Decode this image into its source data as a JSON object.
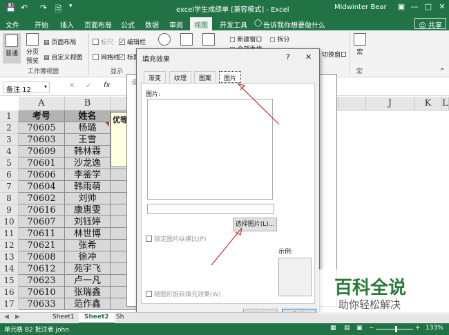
{
  "window": {
    "title": "excel学生成绩单 [兼容模式] - Excel",
    "user": "Midwinter Bear",
    "accent_color": "#217346"
  },
  "qat": {
    "save_icon": "save-icon",
    "undo_icon": "undo-icon",
    "redo_icon": "redo-icon",
    "new_icon": "new-icon"
  },
  "menu": {
    "tabs": [
      "文件",
      "开始",
      "插入",
      "页面布局",
      "公式",
      "数据",
      "审阅",
      "视图",
      "开发工具"
    ],
    "tell_me": "告诉我你想要做什么",
    "share": "共享"
  },
  "ribbon": {
    "normal": "普通",
    "page_break": "分页\n预览",
    "page_layout": "页面布局",
    "custom_view": "自定义视图",
    "workbook_views_label": "工作簿视图",
    "ruler": "标尺",
    "formula_bar": "编辑栏",
    "gridlines": "网格线",
    "headings": "标题",
    "show_label": "显示",
    "new_window": "新建窗口",
    "arrange_all": "全部重排",
    "split": "拆分",
    "switch_windows": "切换窗口",
    "macros": "宏",
    "macros_label": "宏"
  },
  "formula_bar": {
    "name_box": "备注 12",
    "fx": "fx"
  },
  "sheet": {
    "columns": [
      "A",
      "B",
      "C",
      "",
      "",
      "",
      "",
      "",
      "",
      "J",
      "K",
      "L"
    ],
    "header_row": [
      "考号",
      "姓名",
      "语"
    ],
    "rows": [
      [
        "70605",
        "杨璐",
        ""
      ],
      [
        "70603",
        "王雪",
        ""
      ],
      [
        "70609",
        "韩林霖",
        ""
      ],
      [
        "70601",
        "沙龙逸",
        ""
      ],
      [
        "70606",
        "李鉴学",
        "12"
      ],
      [
        "70604",
        "韩雨萌",
        "12"
      ],
      [
        "70602",
        "刘帅",
        "12"
      ],
      [
        "70616",
        "康惠雯",
        "12"
      ],
      [
        "70607",
        "刘钰婷",
        "12"
      ],
      [
        "70611",
        "林世博",
        "12"
      ],
      [
        "70621",
        "张希",
        "12"
      ],
      [
        "70608",
        "徐冲",
        "12"
      ],
      [
        "70612",
        "苑宇飞",
        "12"
      ],
      [
        "70623",
        "卢一凡",
        "12"
      ],
      [
        "70610",
        "张瑞鑫",
        "12"
      ],
      [
        "70633",
        "范作鑫",
        "12"
      ]
    ],
    "comment_text": "优等"
  },
  "sheet_tabs": [
    "Sheet1",
    "Sheet2",
    "Sh"
  ],
  "status": {
    "text": "单元格 B2 批注者 john",
    "zoom": "133%"
  },
  "bg_dialog": {
    "title": "设置"
  },
  "dialog": {
    "title": "填充效果",
    "help": "?",
    "close": "✕",
    "tabs": [
      "渐变",
      "纹理",
      "图案",
      "图片"
    ],
    "picture_label": "图片:",
    "select_button": "选择图片(L)...",
    "lock_aspect": "锁定图片纵横比(P)",
    "rotate_with_shape": "随图形旋转填充效果(W)",
    "sample_label": "示例:",
    "ok": "确定",
    "cancel": "取消"
  },
  "watermark": {
    "title": "百科全说",
    "subtitle": "助你轻松解决"
  }
}
